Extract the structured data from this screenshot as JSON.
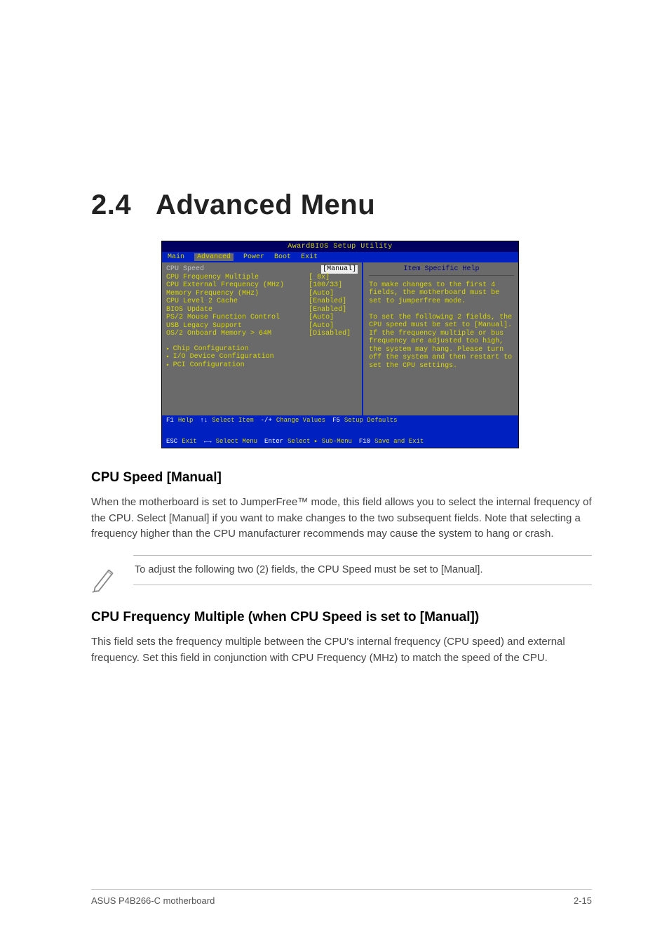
{
  "section_number": "2.4",
  "section_title": "Advanced Menu",
  "bios": {
    "title": "AwardBIOS Setup Utility",
    "menu": {
      "main": "Main",
      "advanced": "Advanced",
      "power": "Power",
      "boot": "Boot",
      "exit": "Exit"
    },
    "help_title": "Item Specific Help",
    "help_text": "To make changes to the first 4 fields, the motherboard must be set to jumperfree mode.\n\nTo set the following 2 fields, the CPU speed must be set to [Manual].\nIf the frequency multiple or bus frequency are adjusted too high, the system may hang. Please turn off the system and then restart to set the CPU settings.",
    "fields": [
      {
        "label": "CPU Speed",
        "value": "[Manual]",
        "highlight": true
      },
      {
        "label": "CPU Frequency Multiple",
        "value": "[ 8x]"
      },
      {
        "label": "CPU External Frequency (MHz)",
        "value": "[100/33]"
      },
      {
        "label": "Memory Frequency (MHz)",
        "value": "[Auto]"
      },
      {
        "label": "CPU Level 2 Cache",
        "value": "[Enabled]"
      },
      {
        "label": "BIOS Update",
        "value": "[Enabled]"
      },
      {
        "label": "PS/2 Mouse Function Control",
        "value": "[Auto]"
      },
      {
        "label": "USB Legacy Support",
        "value": "[Auto]"
      },
      {
        "label": "OS/2 Onboard Memory > 64M",
        "value": "[Disabled]"
      }
    ],
    "submenus": [
      "Chip Configuration",
      "I/O Device Configuration",
      "PCI Configuration"
    ],
    "footer": {
      "f1": "F1",
      "help": "Help",
      "arrows_v": "↑↓",
      "select_item": "Select Item",
      "pm": "-/+",
      "change_values": "Change Values",
      "f5": "F5",
      "setup_defaults": "Setup Defaults",
      "esc": "ESC",
      "exit": "Exit",
      "arrows_h": "←→",
      "select_menu": "Select Menu",
      "enter": "Enter",
      "select_sub": "Select ▸ Sub-Menu",
      "f10": "F10",
      "save_exit": "Save and Exit"
    }
  },
  "cpu_speed": {
    "heading": "CPU Speed [Manual]",
    "para": "When the motherboard is set to JumperFree™ mode, this field allows you to select the internal frequency of the CPU. Select [Manual] if you want to make changes to the two subsequent fields. Note that selecting a frequency higher than the CPU manufacturer recommends may cause the system to hang or crash.",
    "note": "To adjust the following two (2) fields, the CPU Speed must be set to [Manual]."
  },
  "cpu_freq_multiple": {
    "heading": "CPU Frequency Multiple (when CPU Speed is set to [Manual])",
    "para": "This field sets the frequency multiple between the CPU's internal frequency (CPU speed) and external frequency. Set this field in conjunction with CPU Frequency (MHz) to match the speed of the CPU."
  },
  "footer": {
    "left": "ASUS P4B266-C motherboard",
    "right": "2-15"
  }
}
